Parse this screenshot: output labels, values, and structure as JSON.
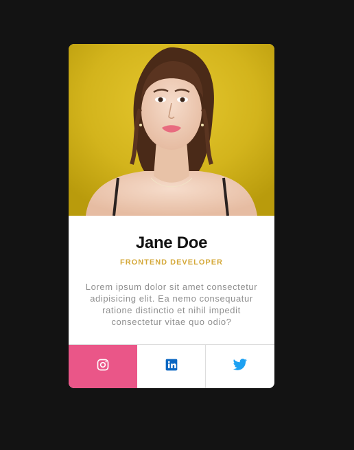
{
  "profile": {
    "name": "Jane Doe",
    "role": "FRONTEND DEVELOPER",
    "bio": "Lorem ipsum dolor sit amet consectetur adipisicing elit. Ea nemo consequatur ratione distinctio et nihil impedit consectetur vitae quo odio?"
  },
  "socials": [
    {
      "icon": "instagram-icon",
      "active": true
    },
    {
      "icon": "linkedin-icon",
      "active": false
    },
    {
      "icon": "twitter-icon",
      "active": false
    }
  ],
  "colors": {
    "page_background": "#131313",
    "card_background": "#ffffff",
    "role_color": "#d4a838",
    "instagram_active_bg": "#ea5688",
    "linkedin_blue": "#0a66c2",
    "twitter_blue": "#1da1f2"
  }
}
